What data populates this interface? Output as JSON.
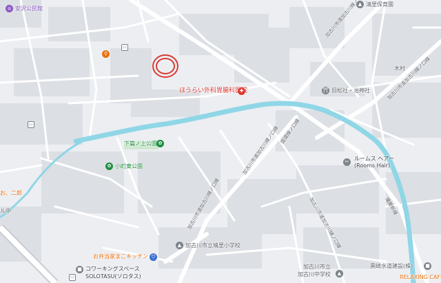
{
  "map": {
    "places": {
      "kominkan": "安沢公民館",
      "hospital": "ほうらい外科胃腸科医院",
      "park_shimo": "下篇ノ上公園",
      "park_komachi": "小町東公園",
      "shrine": "旧松社・治神社",
      "hoikuen": "鴻里保育園",
      "kimura": "木村",
      "salon_line1": "ルームス ヘアー",
      "salon_line2": "(Rooms Hair)",
      "bento": "お弁当家まこキッチン",
      "coworking_line1": "コワーキングスペース",
      "coworking_line2": "SOLOTASU(ソロタス)",
      "school_elem": "加古川市立鳩里小学校",
      "school_junior_line1": "加古川市立",
      "school_junior_line2": "加古川中学校",
      "construction": "黒崎水道建設(株)",
      "cafe": "RELAXING CAFE",
      "shop_left": "お、二郎",
      "left_small": "ル中"
    },
    "roads": {
      "main_road": "加古川市道加古川線ノ口線",
      "upper_road": "加古川市道加古川線ノ口線",
      "middle_road": "加古川市道加古川線ノ口線",
      "lower_road": "加古川市道加古川線ノ口線",
      "river_road": "国道線ノ口線",
      "right_road": "加古川市道加古川線ノ口線",
      "east_road": "播磨新線"
    },
    "icons": {
      "kominkan": "library-pin-icon",
      "hospital": "hospital-pin-icon",
      "park": "park-pin-icon",
      "shrine": "shrine-pin-icon",
      "hoikuen": "school-pin-icon",
      "salon": "salon-pin-icon",
      "restaurant": "restaurant-pin-icon",
      "bento": "shopping-pin-icon",
      "school": "school-pin-icon",
      "bus": "bus-stop-icon",
      "target": "selected-location-ring-icon"
    },
    "colors": {
      "background": "#eceef2",
      "block": "#dcdfe4",
      "road": "#ffffff",
      "river": "#8fd6e6",
      "accent_red": "#d93a32"
    }
  }
}
